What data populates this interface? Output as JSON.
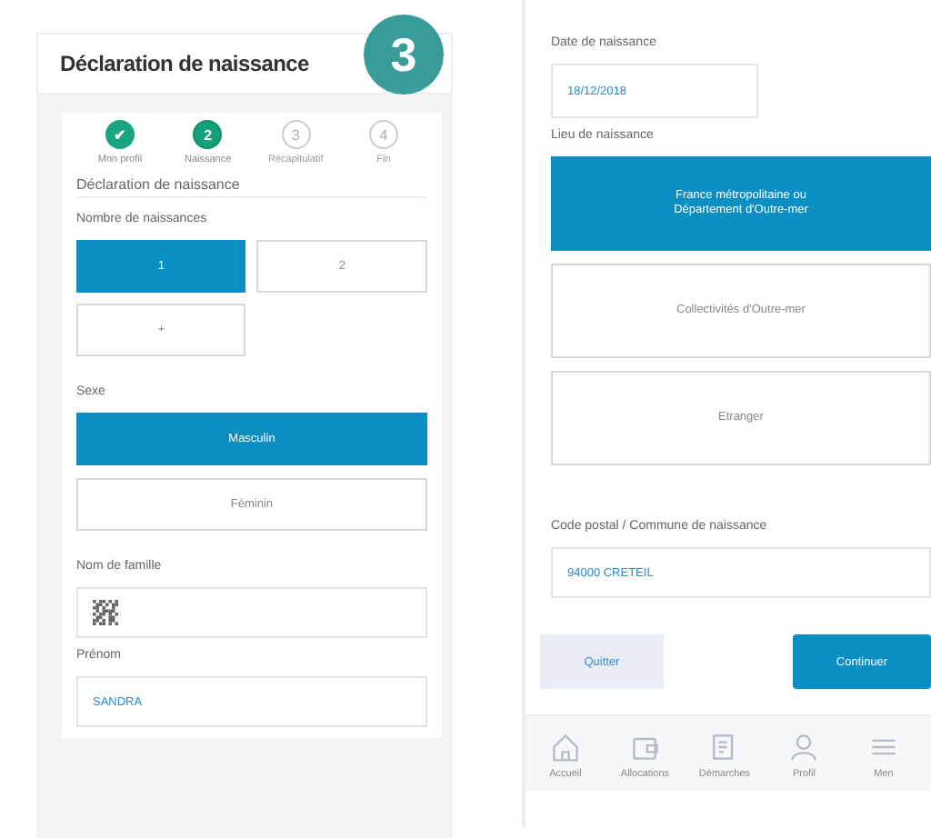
{
  "left_screen": {
    "title": "Déclaration de naissance",
    "badge": "3",
    "steps": [
      {
        "label": "Mon profil",
        "marker": "✔",
        "completed": true,
        "selected": false
      },
      {
        "label": "Naissance",
        "marker": "2",
        "completed": false,
        "selected": true
      },
      {
        "label": "Récapitulatif",
        "marker": "3",
        "completed": false,
        "selected": false
      },
      {
        "label": "Fin",
        "marker": "4",
        "completed": false,
        "selected": false
      }
    ],
    "section_title": "Déclaration de naissance",
    "births": {
      "label": "Nombre de naissances",
      "options": [
        {
          "label": "1",
          "selected": true
        },
        {
          "label": "2",
          "selected": false
        },
        {
          "label": "+",
          "selected": false
        }
      ]
    },
    "sex": {
      "label": "Sexe",
      "options": [
        {
          "label": "Masculin",
          "selected": true
        },
        {
          "label": "Féminin",
          "selected": false
        }
      ]
    },
    "family_name": {
      "label": "Nom de famille"
    },
    "first_name": {
      "label": "Prénom",
      "value": "SANDRA"
    }
  },
  "right_screen": {
    "birth_date": {
      "label": "Date de naissance",
      "value": "18/12/2018"
    },
    "birth_place": {
      "label": "Lieu de naissance",
      "options": [
        {
          "label": "France métropolitaine ou\nDépartement d'Outre-mer",
          "selected": true
        },
        {
          "label": "Collectivités d'Outre-mer",
          "selected": false
        },
        {
          "label": "Etranger",
          "selected": false
        }
      ]
    },
    "postal": {
      "label": "Code postal / Commune de naissance",
      "value": "94000 CRETEIL"
    },
    "buttons": [
      {
        "label": "Quitter",
        "kind": "secondary"
      },
      {
        "label": "Continuer",
        "kind": "primary"
      }
    ],
    "nav": [
      {
        "label": "Accueil",
        "kind": "home"
      },
      {
        "label": "Allocations",
        "kind": "wallet"
      },
      {
        "label": "Démarches",
        "kind": "document"
      },
      {
        "label": "Profil",
        "kind": "person"
      },
      {
        "label": "Men",
        "kind": "menu"
      }
    ]
  }
}
